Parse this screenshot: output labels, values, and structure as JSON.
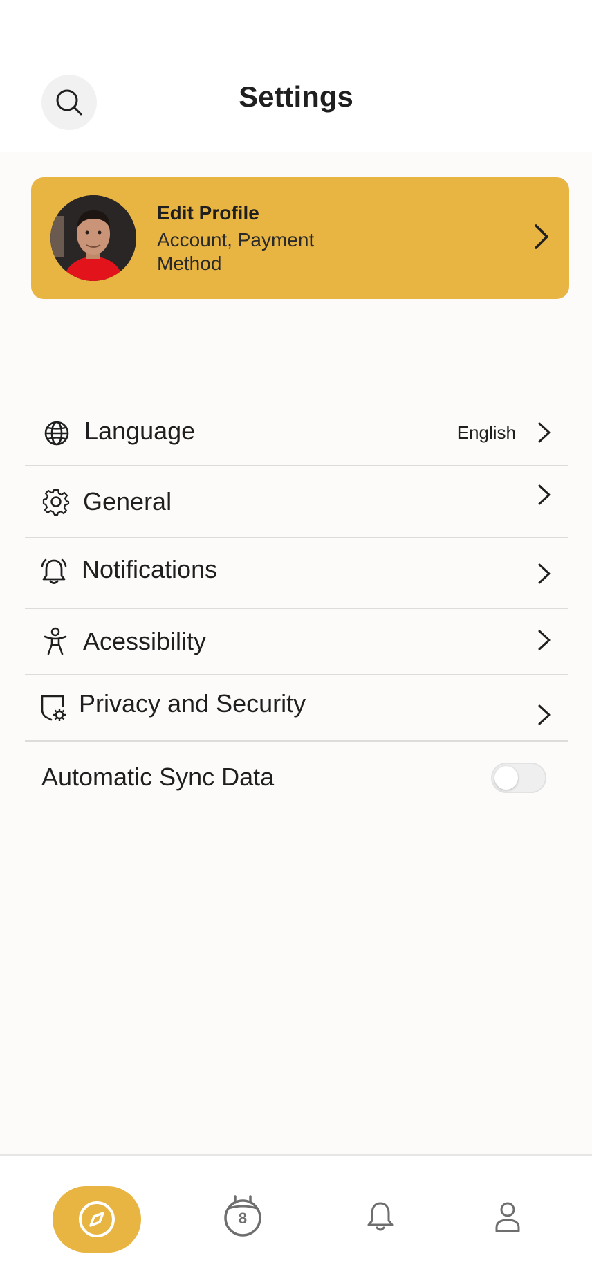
{
  "header": {
    "title": "Settings",
    "search_icon": "search-icon"
  },
  "profile": {
    "title": "Edit Profile",
    "subtitle": "Account, Payment Method",
    "avatar": "avatar-photo",
    "background_color": "#e8b542"
  },
  "settings": {
    "language": {
      "label": "Language",
      "value": "English",
      "icon": "globe-icon"
    },
    "general": {
      "label": "General",
      "icon": "gear-icon"
    },
    "notifications": {
      "label": "Notifications",
      "icon": "alarm-bell-icon"
    },
    "accessibility": {
      "label": "Acessibility",
      "icon": "accessibility-icon"
    },
    "privacy": {
      "label": "Privacy and Security",
      "icon": "shield-gear-icon"
    },
    "sync": {
      "label": "Automatic Sync Data",
      "enabled": false
    }
  },
  "bottom_nav": {
    "items": [
      {
        "name": "explore",
        "icon": "compass-icon",
        "active": true
      },
      {
        "name": "calendar",
        "icon": "calendar-icon",
        "badge": "8",
        "active": false
      },
      {
        "name": "notifications",
        "icon": "bell-icon",
        "active": false
      },
      {
        "name": "profile",
        "icon": "user-icon",
        "active": false
      }
    ]
  },
  "colors": {
    "accent": "#e8b542",
    "text": "#1f1f1f",
    "background": "#fcfbfa",
    "divider": "#dcdcdc"
  }
}
